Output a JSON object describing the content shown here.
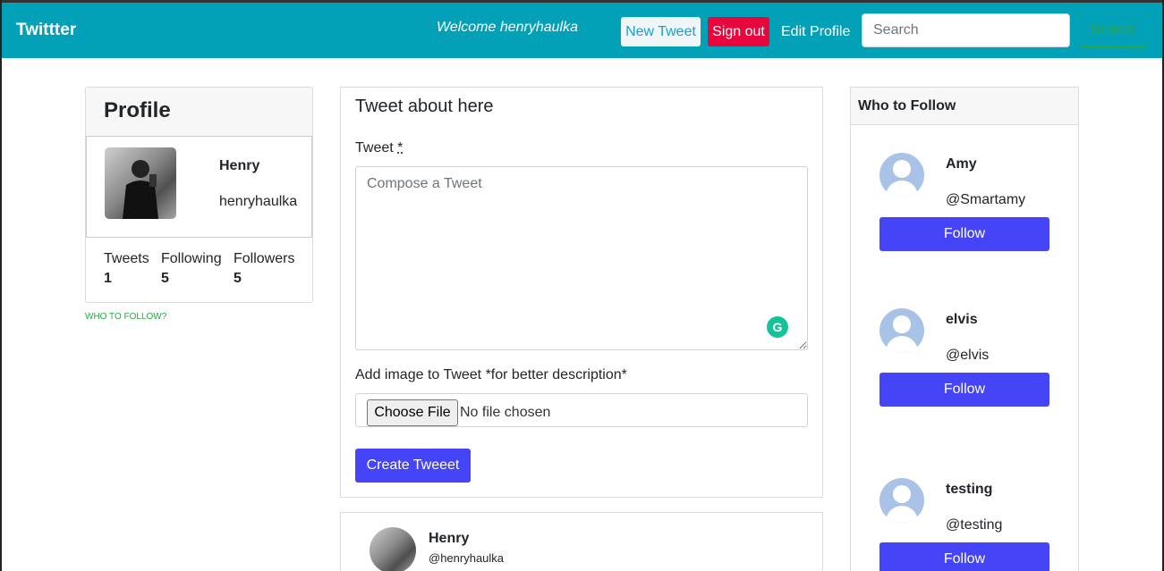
{
  "navbar": {
    "brand": "Twittter",
    "welcome": "Welcome henryhaulka",
    "new_tweet": "New Tweet",
    "sign_out": "Sign out",
    "edit_profile": "Edit Profile",
    "search_placeholder": "Search",
    "search_button": "Search"
  },
  "profile": {
    "heading": "Profile",
    "name": "Henry",
    "handle": "henryhaulka",
    "stats": [
      {
        "label": "Tweets",
        "value": "1"
      },
      {
        "label": "Following",
        "value": "5"
      },
      {
        "label": "Followers",
        "value": "5"
      }
    ],
    "who_to_follow_link": "WHO TO FOLLOW?"
  },
  "tweet_form": {
    "title": "Tweet about here",
    "label": "Tweet",
    "required_mark": "*",
    "placeholder": "Compose a Tweet",
    "image_label": "Add image to Tweet *for better description*",
    "choose_file": "Choose File",
    "no_file": "No file chosen",
    "submit": "Create Tweeet"
  },
  "post": {
    "name": "Henry",
    "handle": "@henryhaulka"
  },
  "who_to_follow": {
    "heading": "Who to Follow",
    "users": [
      {
        "name": "Amy",
        "handle": "@Smartamy",
        "button": "Follow"
      },
      {
        "name": "elvis",
        "handle": "@elvis",
        "button": "Follow"
      },
      {
        "name": "testing",
        "handle": "@testing",
        "button": "Follow"
      }
    ]
  },
  "colors": {
    "navbar": "#03a1b7",
    "sign_out": "#e8063c",
    "primary_button": "#4545f7",
    "success": "#28a745"
  }
}
